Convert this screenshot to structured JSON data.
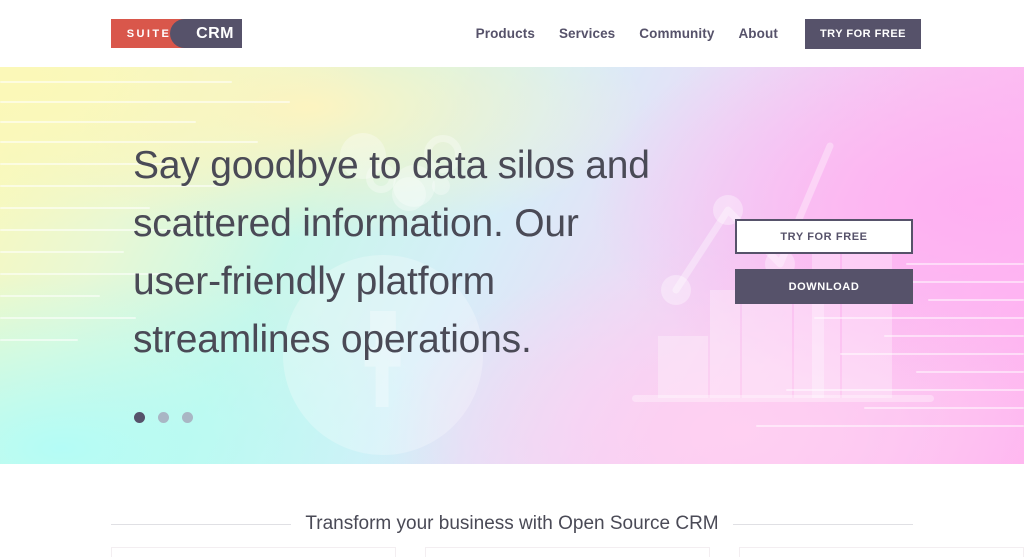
{
  "header": {
    "logo": {
      "suite": "SUITE",
      "crm": "CRM"
    },
    "nav": [
      {
        "label": "Products"
      },
      {
        "label": "Services"
      },
      {
        "label": "Community"
      },
      {
        "label": "About"
      }
    ],
    "cta_label": "TRY FOR FREE"
  },
  "hero": {
    "title": "Say goodbye to data silos and scattered information. Our user-friendly platform streamlines operations.",
    "buttons": [
      {
        "label": "TRY FOR FREE",
        "style": "light"
      },
      {
        "label": "DOWNLOAD",
        "style": "dark"
      }
    ],
    "carousel": {
      "slides": 3,
      "active_index": 0
    }
  },
  "section": {
    "tagline": "Transform your business with Open Source CRM"
  },
  "colors": {
    "brand_red": "#d9574b",
    "brand_dark": "#56526a",
    "text": "#4a4a56",
    "dot_inactive": "#a9b6c4",
    "rule": "#e0e0e4"
  }
}
